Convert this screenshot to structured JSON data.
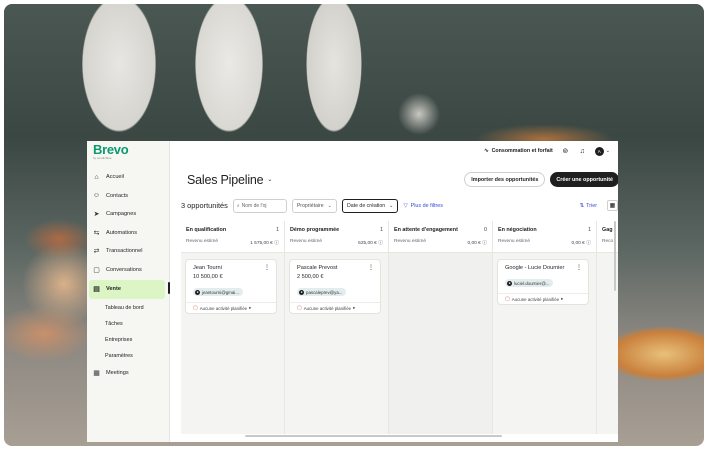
{
  "brand": {
    "name": "Brevo",
    "tagline": "by sendinblue"
  },
  "sidebar": {
    "items": [
      {
        "label": "Accueil",
        "icon": "home-icon"
      },
      {
        "label": "Contacts",
        "icon": "contacts-icon"
      },
      {
        "label": "Campagnes",
        "icon": "send-icon"
      },
      {
        "label": "Automations",
        "icon": "automation-icon"
      },
      {
        "label": "Transactionnel",
        "icon": "transactional-icon"
      },
      {
        "label": "Conversations",
        "icon": "chat-icon"
      },
      {
        "label": "Vente",
        "icon": "sales-icon",
        "active": true
      }
    ],
    "sub_items": [
      "Tableau de bord",
      "Tâches",
      "Entreprises",
      "Paramètres"
    ],
    "bottom_item": {
      "label": "Meetings",
      "icon": "calendar-icon"
    }
  },
  "topbar": {
    "consumption": "Consommation et forfait",
    "avatar_initial": "A"
  },
  "header": {
    "title": "Sales Pipeline",
    "import_button": "Importer des opportunités",
    "create_button": "Créer une opportunité"
  },
  "filters": {
    "count": "3 opportunités",
    "search_placeholder": "Nom de l'oj",
    "owner": "Propriétaire",
    "date": "Date de création",
    "more": "Plus de filtres",
    "sort": "Trier"
  },
  "columns": [
    {
      "title": "En qualification",
      "count": "1",
      "est_label": "Revenu estimé",
      "amount": "1 575,00 €",
      "cards": [
        {
          "name": "Jean Tourni",
          "amount": "10 500,00 €",
          "contact": "jeantourni@gmai...",
          "activity": "Aucune activité planifiée"
        }
      ]
    },
    {
      "title": "Démo programmée",
      "count": "1",
      "est_label": "Revenu estimé",
      "amount": "625,00 €",
      "cards": [
        {
          "name": "Pascale Prevost",
          "amount": "2 500,00 €",
          "contact": "pascaleprev@ya...",
          "activity": "Aucune activité planifiée"
        }
      ]
    },
    {
      "title": "En attente d'engagement",
      "count": "0",
      "est_label": "Revenu estimé",
      "amount": "0,00 €",
      "cards": []
    },
    {
      "title": "En négociation",
      "count": "1",
      "est_label": "Revenu estimé",
      "amount": "0,00 €",
      "cards": [
        {
          "name": "Google - Lucie Dournier",
          "amount": "",
          "contact": "luciel.dournier@...",
          "activity": "Aucune activité planifiée"
        }
      ]
    },
    {
      "title": "Gag",
      "count": "",
      "est_label": "Reco",
      "amount": "",
      "cards": []
    }
  ],
  "colors": {
    "brand_green": "#0b996e",
    "active_nav": "#dcf5c4",
    "link_blue": "#3a4ad8",
    "dark": "#1f1f1f"
  }
}
